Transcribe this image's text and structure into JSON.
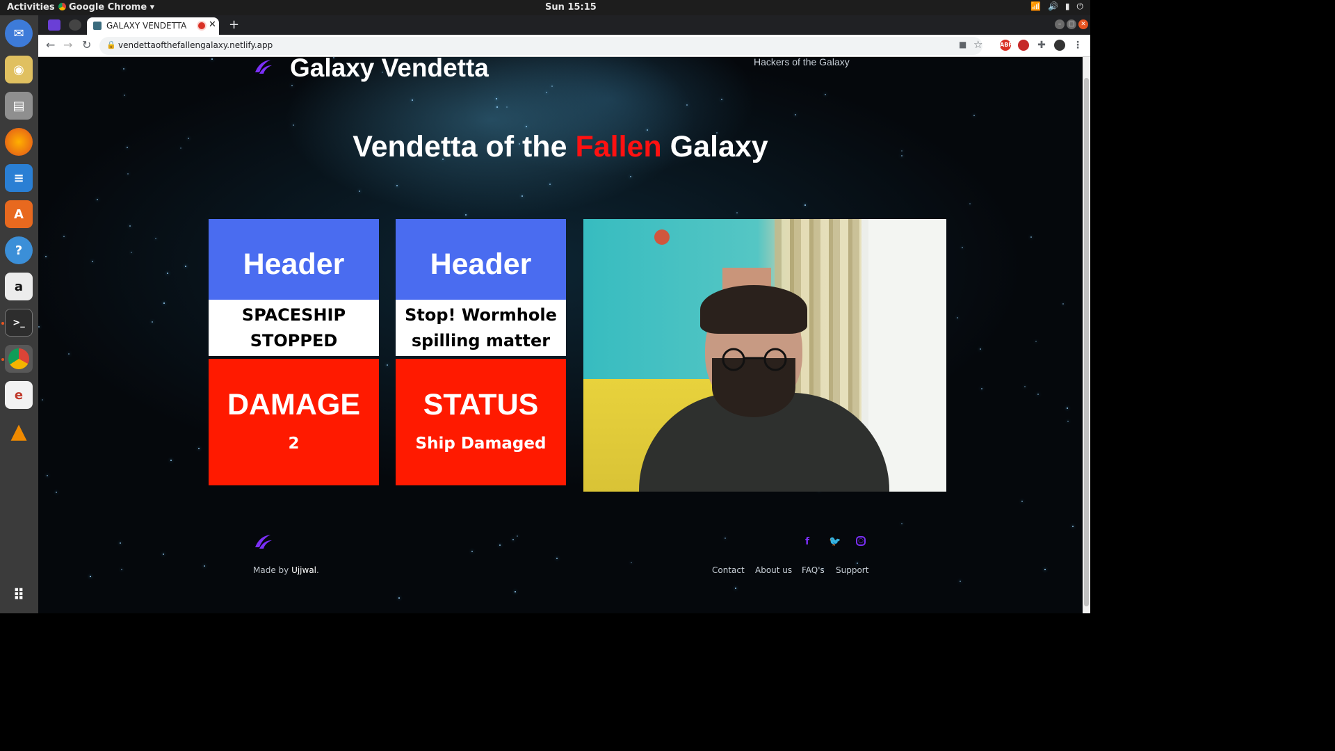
{
  "os": {
    "activities": "Activities",
    "app_menu": "Google Chrome ▾",
    "clock": "Sun 15:15",
    "tray": [
      "wifi-icon",
      "volume-icon",
      "battery-icon",
      "power-icon"
    ]
  },
  "browser": {
    "tab_title": "GALAXY VENDETTA",
    "tab_close": "✕",
    "new_tab": "+",
    "url": "vendettaofthefallengalaxy.netlify.app",
    "extensions": [
      "ABP"
    ]
  },
  "site": {
    "brand": "Galaxy Vendetta",
    "nav_link": "Hackers of the Galaxy",
    "hero": {
      "before": "Vendetta of the ",
      "accent": "Fallen",
      "after": " Galaxy"
    },
    "accent_color": "#ff1111",
    "cards": [
      {
        "header": "Header",
        "body": "SPACESHIP STOPPED"
      },
      {
        "header": "Header",
        "body": "Stop! Wormhole spilling matter"
      }
    ],
    "stats": [
      {
        "title": "DAMAGE",
        "value": "2"
      },
      {
        "title": "STATUS",
        "value": "Ship Damaged"
      }
    ],
    "footer": {
      "made_by": "Made by ",
      "author": "Ujjwal",
      "period": ".",
      "links": [
        "Contact",
        "About us",
        "FAQ's",
        "Support"
      ],
      "social": [
        "facebook-icon",
        "twitter-icon",
        "instagram-icon"
      ]
    }
  }
}
